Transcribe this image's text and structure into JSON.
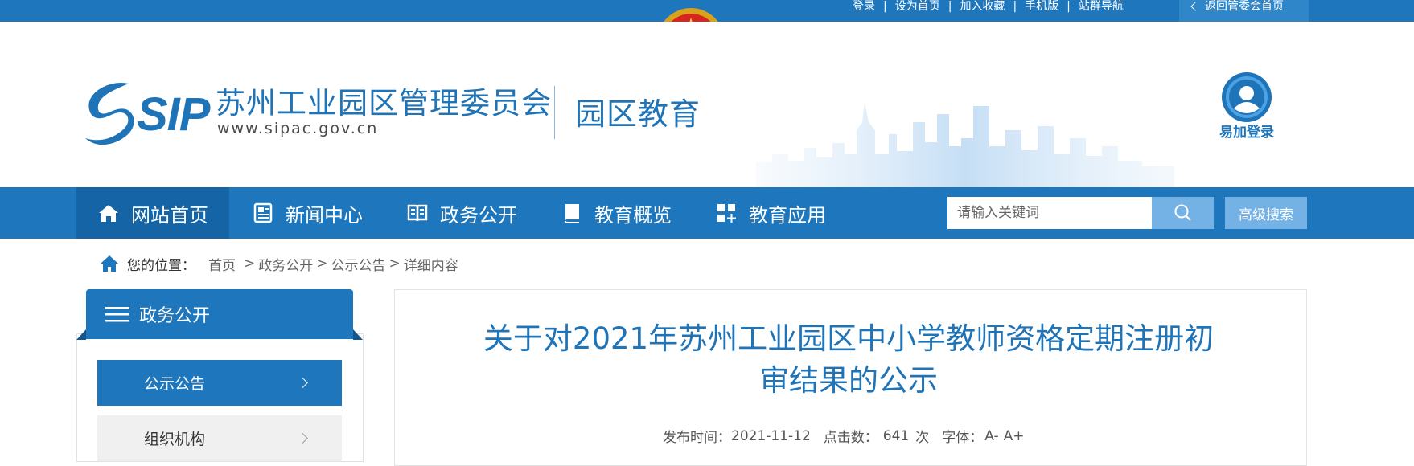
{
  "topbar": {
    "links": [
      "登录",
      "设为首页",
      "加入收藏",
      "手机版",
      "站群导航"
    ],
    "separator": "|",
    "back_label": "返回管委会首页"
  },
  "header": {
    "logo_text": "SIP",
    "site_title": "苏州工业园区管理委员会",
    "site_url": "www.sipac.gov.cn",
    "section_name": "园区教育",
    "login_label": "易加登录"
  },
  "nav": {
    "items": [
      {
        "label": "网站首页",
        "icon": "home-icon"
      },
      {
        "label": "新闻中心",
        "icon": "newspaper-icon"
      },
      {
        "label": "政务公开",
        "icon": "book-icon"
      },
      {
        "label": "教育概览",
        "icon": "booklet-icon"
      },
      {
        "label": "教育应用",
        "icon": "apps-icon"
      }
    ],
    "search_placeholder": "请输入关键词",
    "advanced_search_label": "高级搜索"
  },
  "breadcrumb": {
    "label": "您的位置：",
    "items": [
      "首页",
      "政务公开",
      "公示公告",
      "详细内容"
    ],
    "separator": ">"
  },
  "sidebar": {
    "title": "政务公开",
    "items": [
      {
        "label": "公示公告",
        "active": true
      },
      {
        "label": "组织机构",
        "active": false
      }
    ]
  },
  "article": {
    "title_line1": "关于对2021年苏州工业园区中小学教师资格定期注册初",
    "title_line2": "审结果的公示",
    "publish_label": "发布时间：",
    "publish_date": "2021-11-12",
    "clicks_label": "点击数：",
    "clicks": "641",
    "clicks_unit": "次",
    "font_label": "字体：",
    "font_smaller": "A-",
    "font_larger": "A+"
  },
  "colors": {
    "primary": "#1e76bd",
    "primary_dark": "#1564a6",
    "search_button": "#74b2e6",
    "title_blue": "#1f73b7"
  }
}
